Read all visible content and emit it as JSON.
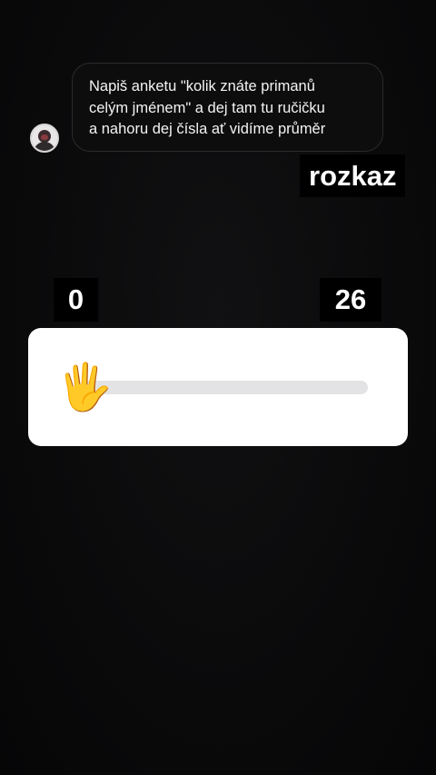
{
  "message": {
    "lines": [
      "Napiš anketu \"kolik znáte primanů",
      "celým jménem\" a dej tam tu ručičku",
      "a nahoru dej čísla ať vidíme průměr"
    ]
  },
  "caption": "rozkaz",
  "slider": {
    "min_label": "0",
    "max_label": "26",
    "value_fraction": 0.0,
    "thumb_emoji": "🖐"
  },
  "colors": {
    "background": "#0a0a0b",
    "card": "#ffffff",
    "track": "#e3e3e5"
  }
}
